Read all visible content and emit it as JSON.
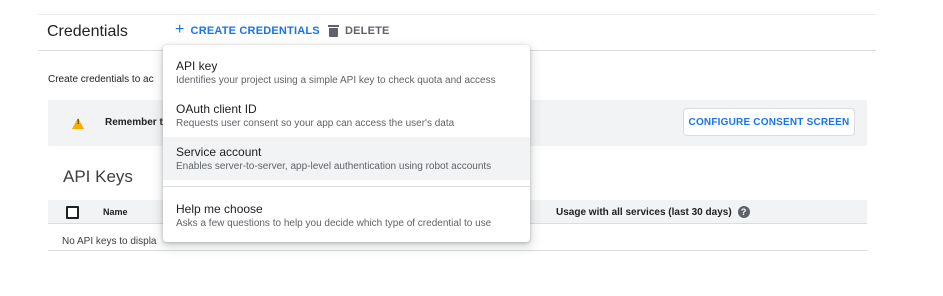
{
  "header": {
    "title": "Credentials",
    "create_label": "CREATE CREDENTIALS",
    "delete_label": "DELETE"
  },
  "intro_text": "Create credentials to ac",
  "banner": {
    "remember_text": "Remember t",
    "consent_label": "CONFIGURE CONSENT SCREEN"
  },
  "api_keys": {
    "title": "API Keys",
    "col_name": "Name",
    "col_usage": "Usage with all services (last 30 days)",
    "empty_text": "No API keys to displa"
  },
  "menu": {
    "items": [
      {
        "title": "API key",
        "desc": "Identifies your project using a simple API key to check quota and access"
      },
      {
        "title": "OAuth client ID",
        "desc": "Requests user consent so your app can access the user's data"
      },
      {
        "title": "Service account",
        "desc": "Enables server-to-server, app-level authentication using robot accounts"
      },
      {
        "title": "Help me choose",
        "desc": "Asks a few questions to help you decide which type of credential to use"
      }
    ]
  },
  "colors": {
    "accent": "#1a73e8",
    "warning": "#f9ab00",
    "hover": "#f1f3f4"
  },
  "icons": [
    "plus-icon",
    "trash-icon",
    "warning-icon",
    "help-icon"
  ]
}
